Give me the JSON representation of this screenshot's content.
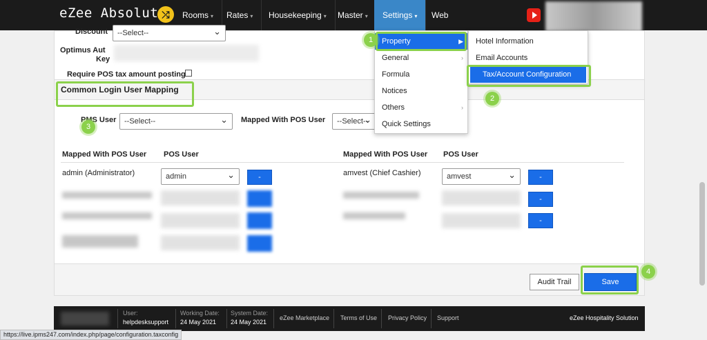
{
  "app": {
    "logo": "eZee Absolute",
    "logo_icon": "shuffle-icon"
  },
  "nav": {
    "rooms": "Rooms",
    "rates": "Rates",
    "housekeeping": "Housekeeping",
    "master": "Master",
    "settings": "Settings",
    "web": "Web"
  },
  "form": {
    "discount_label": "Discount",
    "discount_value": "--Select--",
    "optimus_label_1": "Optimus Aut",
    "optimus_label_2": "Key",
    "require_pos_label": "Require POS tax amount posting?",
    "require_pos_checked": false
  },
  "section": {
    "title": "Common Login User Mapping"
  },
  "mapping_filter": {
    "pms_user_label": "PMS User",
    "pms_user_value": "--Select--",
    "mapped_pos_label": "Mapped With POS User",
    "mapped_pos_value": "--Select--"
  },
  "table": {
    "col_mapped": "Mapped With POS User",
    "col_pos": "POS User",
    "left_rows": [
      {
        "user": "admin (Administrator)",
        "pos": "admin",
        "btn": "-"
      }
    ],
    "right_rows": [
      {
        "user": "amvest (Chief Cashier)",
        "pos": "amvest",
        "btn": "-"
      },
      {
        "btn": "-"
      },
      {
        "btn": "-"
      }
    ]
  },
  "settings_menu": {
    "items": [
      {
        "label": "Property",
        "active": true
      },
      {
        "label": "General"
      },
      {
        "label": "Formula"
      },
      {
        "label": "Notices"
      },
      {
        "label": "Others"
      },
      {
        "label": "Quick Settings"
      }
    ]
  },
  "property_submenu": {
    "items": [
      {
        "label": "Hotel Information"
      },
      {
        "label": "Email Accounts"
      },
      {
        "label": "Tax/Account Configuration",
        "active": true
      }
    ]
  },
  "steps": [
    "1",
    "2",
    "3",
    "4"
  ],
  "buttons": {
    "audit_trail": "Audit Trail",
    "save": "Save"
  },
  "footer": {
    "user_label": "User:",
    "user_value": "helpdesksupport",
    "working_label": "Working Date:",
    "working_value": "24 May 2021",
    "system_label": "System Date:",
    "system_value": "24 May 2021",
    "links": [
      "eZee Marketplace",
      "Terms of Use",
      "Privacy Policy",
      "Support"
    ],
    "brand": "eZee Hospitality Solution"
  },
  "status_url": "https://live.ipms247.com/index.php/page/configuration.taxconfig",
  "colors": {
    "accent": "#1a6de8",
    "highlight": "#8bd14b",
    "nav_bg": "#1b1b1b",
    "nav_active": "#3a87c8"
  }
}
